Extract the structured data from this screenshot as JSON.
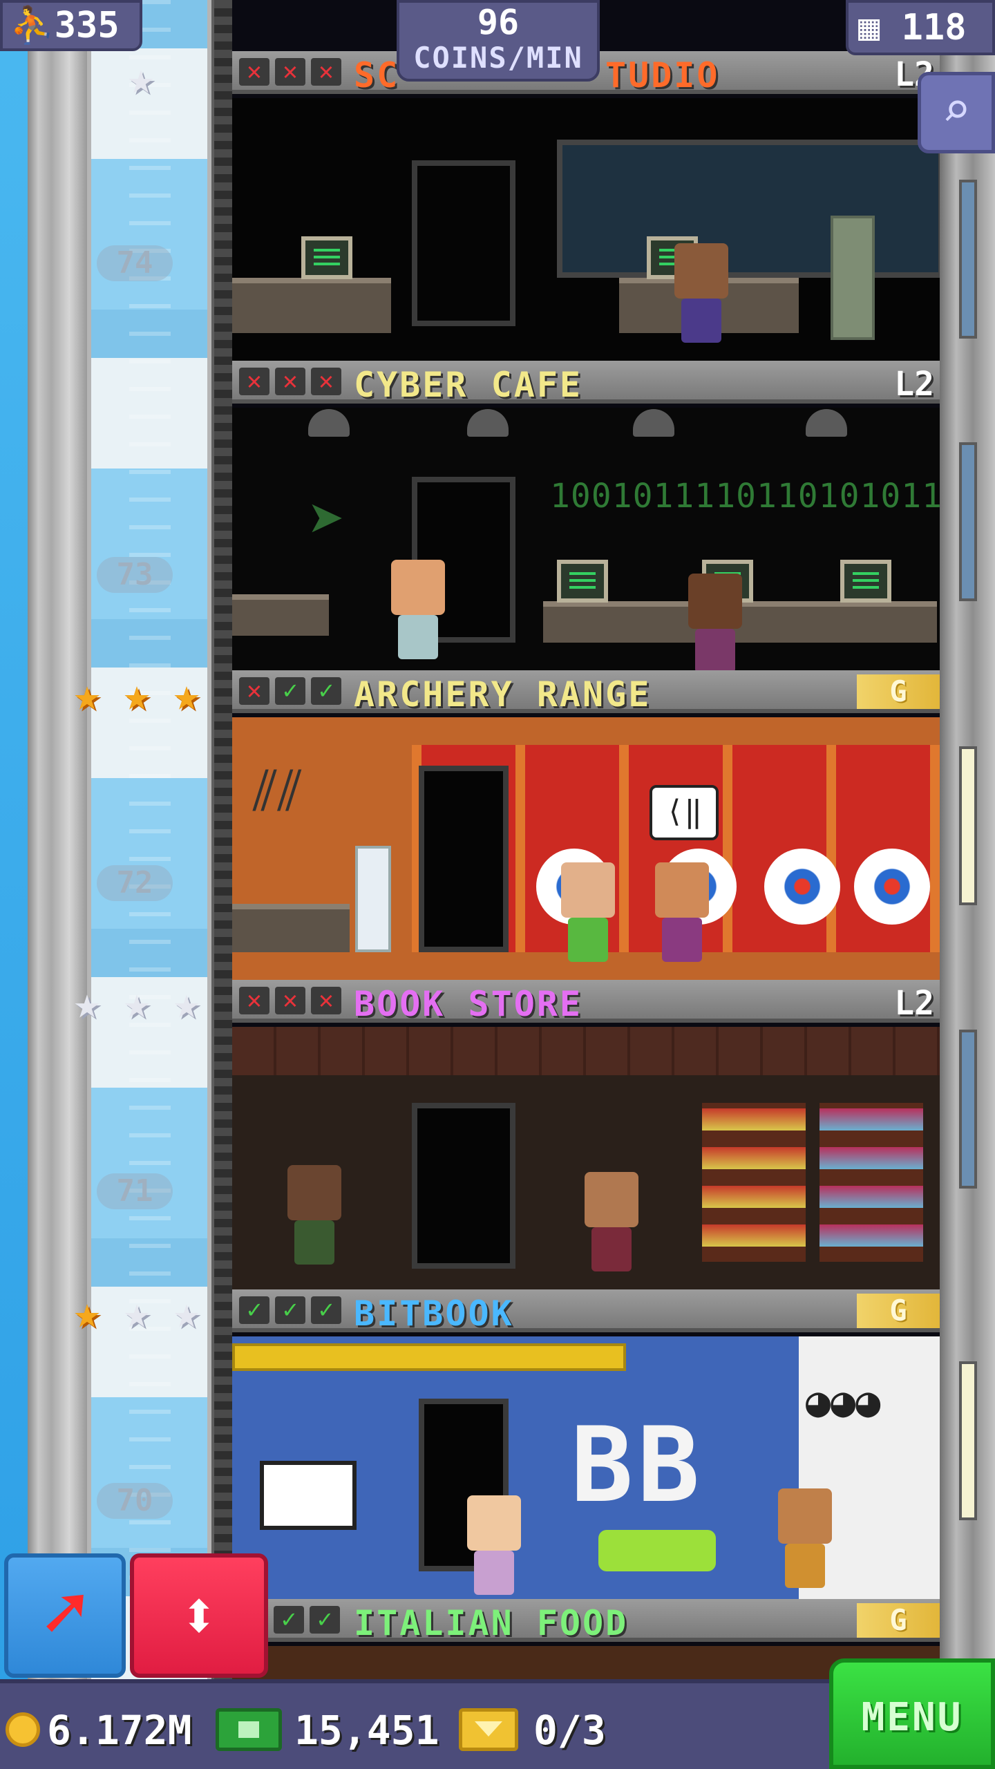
{
  "hud": {
    "population": "335",
    "coins_per_min_value": "96",
    "coins_per_min_label": "COINS/MIN",
    "floor_count": "118"
  },
  "bottom": {
    "coins": "6.172M",
    "bux": "15,451",
    "tickets": "0/3",
    "menu_label": "MENU"
  },
  "floor_numbers": [
    "74",
    "73",
    "72",
    "71",
    "70"
  ],
  "floors": [
    {
      "name": "SOFTWARE STUDIO",
      "name_visible": "SC",
      "name_visible_right": "TUDIO",
      "color": "#ff6b2a",
      "marks": [
        "x",
        "x",
        "x"
      ],
      "tag": "L2"
    },
    {
      "name": "CYBER CAFE",
      "color": "#f2e88a",
      "marks": [
        "x",
        "x",
        "x"
      ],
      "tag": "L2",
      "binary_text": "1001011110110101011"
    },
    {
      "name": "ARCHERY RANGE",
      "color": "#f2e88a",
      "marks": [
        "x",
        "ok",
        "ok"
      ],
      "tag": "G",
      "stars": [
        "gold",
        "gold",
        "gold"
      ]
    },
    {
      "name": "BOOK STORE",
      "color": "#e46ff2",
      "marks": [
        "x",
        "x",
        "x"
      ],
      "tag": "L2",
      "stars": [
        "silver",
        "silver",
        "silver"
      ]
    },
    {
      "name": "BITBOOK",
      "color": "#4ab8ff",
      "marks": [
        "ok",
        "ok",
        "ok"
      ],
      "tag": "G",
      "stars": [
        "gold",
        "silver",
        "silver"
      ],
      "logo": "BB"
    },
    {
      "name": "ITALIAN FOOD",
      "color": "#7df07a",
      "marks": [
        "ok",
        "ok"
      ],
      "tag": "G"
    }
  ],
  "icons": {
    "population": "person-icon",
    "floors": "building-icon",
    "search": "magnifier-icon",
    "build": "red-arrow-icon",
    "elevator": "up-down-arrows-icon",
    "coin": "coin-icon",
    "bux": "bux-icon",
    "ticket": "ticket-icon"
  },
  "colors": {
    "hud_bg": "#5a5a88",
    "menu_green": "#2ec93a",
    "elevator_red": "#e11d42",
    "build_blue": "#3d97e2"
  }
}
